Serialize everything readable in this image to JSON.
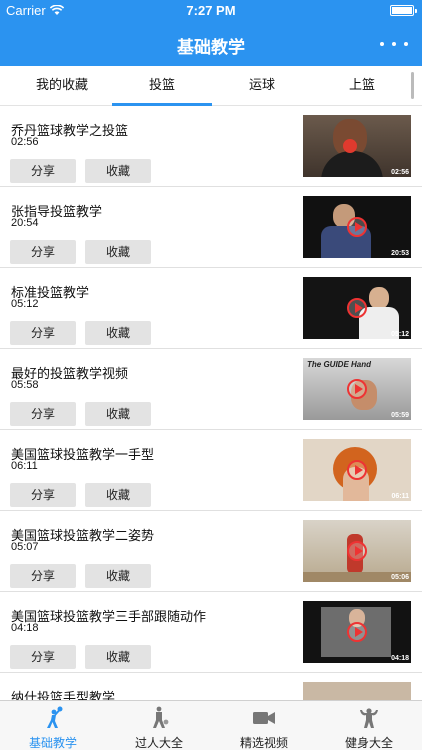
{
  "status": {
    "carrier": "Carrier",
    "time": "7:27 PM"
  },
  "nav": {
    "title": "基础教学"
  },
  "tabs": [
    {
      "label": "我的收藏"
    },
    {
      "label": "投篮"
    },
    {
      "label": "运球"
    },
    {
      "label": "上篮"
    }
  ],
  "actions": {
    "share": "分享",
    "favorite": "收藏"
  },
  "videos": [
    {
      "title": "乔丹篮球教学之投篮",
      "duration": "02:56",
      "badge": "02:56"
    },
    {
      "title": "张指导投篮教学",
      "duration": "20:54",
      "badge": "20:53"
    },
    {
      "title": "标准投篮教学",
      "duration": "05:12",
      "badge": "05:12"
    },
    {
      "title": "最好的投篮教学视频",
      "duration": "05:58",
      "badge": "05:59",
      "caption": "The GUIDE Hand"
    },
    {
      "title": "美国篮球投篮教学一手型",
      "duration": "06:11",
      "badge": "06:11"
    },
    {
      "title": "美国篮球投篮教学二姿势",
      "duration": "05:07",
      "badge": "05:06"
    },
    {
      "title": "美国篮球投篮教学三手部跟随动作",
      "duration": "04:18",
      "badge": "04:18"
    },
    {
      "title": "纳什投篮手型教学",
      "duration": "",
      "badge": ""
    }
  ],
  "bottom_tabs": [
    {
      "label": "基础教学",
      "icon": "player-shooting-icon"
    },
    {
      "label": "过人大全",
      "icon": "player-dribbling-icon"
    },
    {
      "label": "精选视频",
      "icon": "video-camera-icon"
    },
    {
      "label": "健身大全",
      "icon": "bodybuilder-icon"
    }
  ],
  "colors": {
    "primary": "#2b93f0",
    "button_bg": "#e3e3e3",
    "play_red": "#ee3333"
  }
}
